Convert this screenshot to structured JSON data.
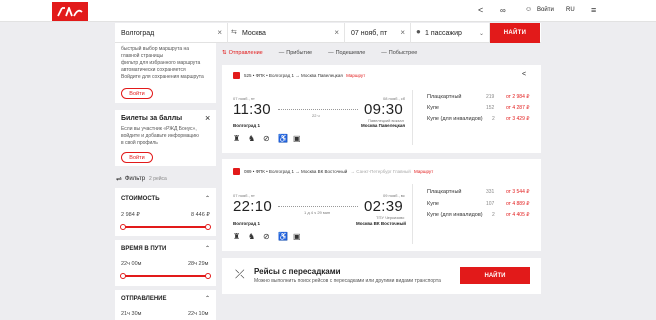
{
  "header": {
    "login": "Войти",
    "lang": "RU"
  },
  "search": {
    "from": "Волгоград",
    "to": "Москва",
    "date": "07 нояб, пт",
    "passengers": "1 пассажир",
    "submit": "НАЙТИ"
  },
  "promo_panel": {
    "lines": [
      "быстрый выбор маршрута на",
      "главной страницы",
      "фильтр для избранного маршрута",
      "автоматически сохраняется",
      "Войдите для сохранения маршрута"
    ],
    "button": "Войти"
  },
  "bonus_panel": {
    "title": "Билеты за баллы",
    "text": [
      "Если вы участник «РЖД Бонус»,",
      "войдите и добавьте информацию",
      "в свой профиль"
    ],
    "button": "Войти"
  },
  "filter": {
    "label": "Фильтр",
    "count": "2 рейса"
  },
  "filters": [
    {
      "title": "СТОИМОСТЬ",
      "min": "2 984 ₽",
      "max": "8 446 ₽"
    },
    {
      "title": "ВРЕМЯ В ПУТИ",
      "min": "22ч 00м",
      "max": "28ч 29м"
    },
    {
      "title": "ОТПРАВЛЕНИЕ",
      "min": "21ч 30м",
      "max": "22ч 10м"
    }
  ],
  "tabs": [
    "Отправление",
    "Прибытие",
    "Подешевле",
    "Побыстрее"
  ],
  "trains": [
    {
      "route": "525 • ФПК • Волгоград 1 → Москва Павелецкая",
      "route_link": "Маршрут",
      "dep_date": "07 нояб., пт",
      "dep_time": "11:30",
      "arr_date": "08 нояб., сб",
      "arr_time": "09:30",
      "duration": "22 ч",
      "dep_station": "Волгоград 1",
      "arr_note": "Павелецкий вокзал",
      "arr_station": "Москва Павелецкая",
      "classes": [
        {
          "name": "Плацкартный",
          "count": "219",
          "price": "от 2 984 ₽"
        },
        {
          "name": "Купе",
          "count": "152",
          "price": "от 4 287 ₽"
        },
        {
          "name": "Купе (для инвалидов)",
          "count": "2",
          "price": "от 3 429 ₽"
        }
      ]
    },
    {
      "route": "089 • ФПК • Волгоград 1 → Москва ВК Восточный",
      "route_extra": "→ Санкт-Петербург Главный",
      "route_link": "Маршрут",
      "dep_date": "07 нояб., пт",
      "dep_time": "22:10",
      "arr_date": "09 нояб., вс",
      "arr_time": "02:39",
      "duration": "1 д 4 ч 29 мин",
      "dep_station": "Волгоград 1",
      "arr_note": "ТПУ Черкизово",
      "arr_station": "Москва ВК Восточный",
      "classes": [
        {
          "name": "Плацкартный",
          "count": "331",
          "price": "от 3 544 ₽"
        },
        {
          "name": "Купе",
          "count": "107",
          "price": "от 4 889 ₽"
        },
        {
          "name": "Купе (для инвалидов)",
          "count": "2",
          "price": "от 4 405 ₽"
        }
      ]
    }
  ],
  "transfer": {
    "title": "Рейсы с пересадками",
    "text": "Можно выполнить поиск рейсов с пересадками или другими видами транспорта",
    "button": "НАЙТИ"
  }
}
